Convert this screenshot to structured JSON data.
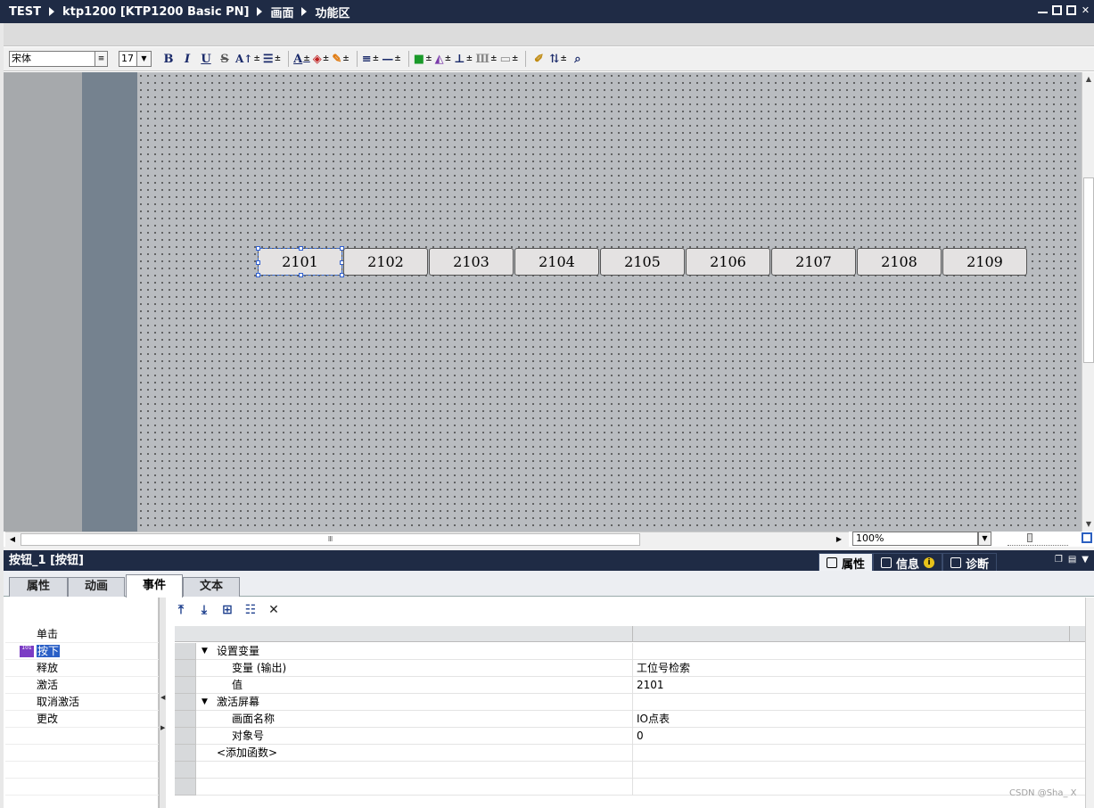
{
  "titlebar": {
    "crumbs": [
      "TEST",
      "ktp1200 [KTP1200 Basic PN]",
      "画面",
      "功能区"
    ]
  },
  "toolbar": {
    "font_name": "宋体",
    "font_size": "17",
    "bold": "B",
    "italic": "I",
    "underline": "U",
    "strike": "S",
    "text_color": "A"
  },
  "canvas": {
    "buttons": [
      "2101",
      "2102",
      "2103",
      "2104",
      "2105",
      "2106",
      "2107",
      "2108",
      "2109"
    ],
    "selected_index": 0,
    "zoom": "100%"
  },
  "panel": {
    "title": "按钮_1 [按钮]",
    "right_tabs": [
      "属性",
      "信息",
      "诊断"
    ],
    "tabs": [
      "属性",
      "动画",
      "事件",
      "文本"
    ],
    "active_tab": "事件",
    "events": [
      "单击",
      "按下",
      "释放",
      "激活",
      "取消激活",
      "更改"
    ],
    "selected_event": "按下",
    "event_icon_text": "101"
  },
  "grid": {
    "rows": [
      {
        "indent": 1,
        "expander": true,
        "name": "设置变量",
        "value": ""
      },
      {
        "indent": 2,
        "expander": false,
        "name": "变量 (输出)",
        "value": "工位号检索"
      },
      {
        "indent": 2,
        "expander": false,
        "name": "值",
        "value": "2101"
      },
      {
        "indent": 1,
        "expander": true,
        "name": "激活屏幕",
        "value": ""
      },
      {
        "indent": 2,
        "expander": false,
        "name": "画面名称",
        "value": "IO点表"
      },
      {
        "indent": 2,
        "expander": false,
        "name": "对象号",
        "value": "0"
      },
      {
        "indent": 1,
        "expander": false,
        "name": "<添加函数>",
        "value": ""
      },
      {
        "indent": 0,
        "expander": false,
        "name": "",
        "value": ""
      },
      {
        "indent": 0,
        "expander": false,
        "name": "",
        "value": ""
      }
    ]
  },
  "watermark": "CSDN @Sha_ X"
}
